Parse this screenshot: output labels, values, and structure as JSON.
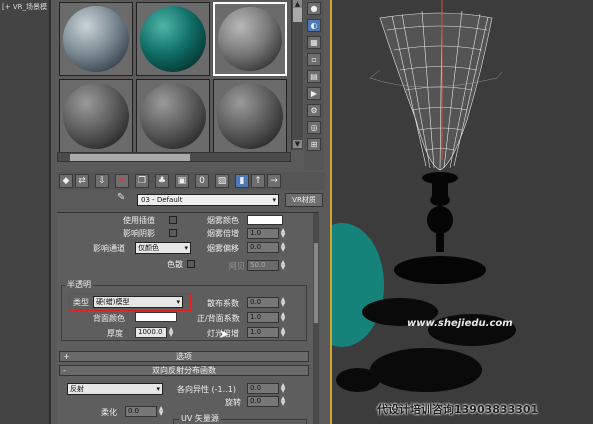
{
  "left_viewport": {
    "label": "[+ VR_场景模"
  },
  "material": {
    "name": "03 - Default",
    "type_button": "VR材质"
  },
  "sample_slots": [
    {
      "index": 1,
      "style": "textured-blue-gray"
    },
    {
      "index": 2,
      "style": "teal-glossy"
    },
    {
      "index": 3,
      "style": "gray-glossy",
      "selected": true
    },
    {
      "index": 4,
      "style": "default-gray"
    },
    {
      "index": 5,
      "style": "default-gray"
    },
    {
      "index": 6,
      "style": "default-gray"
    }
  ],
  "fog": {
    "use_interpolation": "使用插值",
    "affect_shadows": "影响阴影",
    "affect_channels": "影响通道",
    "affect_channels_value": "仅颜色",
    "dispersion": "色散",
    "fog_color": "烟雾颜色",
    "fog_multiplier": "烟雾倍增",
    "fog_multiplier_value": "1.0",
    "fog_bias": "烟雾偏移",
    "fog_bias_value": "0.0",
    "abbe": "阿贝",
    "abbe_value": "50.0"
  },
  "translucency": {
    "group_title": "半透明",
    "type_label": "类型",
    "type_value": "硬(蜡)模型",
    "scatter_coef": "散布系数",
    "scatter_coef_value": "0.0",
    "back_color": "背面颜色",
    "fwd_bck_coef": "正/背面系数",
    "fwd_bck_coef_value": "1.0",
    "thickness": "厚度",
    "thickness_value": "1000.0",
    "light_multiplier": "灯光倍增",
    "light_multiplier_value": "1.0"
  },
  "rollouts": {
    "options": "选项",
    "brdf": "双向反射分布函数"
  },
  "brdf": {
    "type_value": "反射",
    "anisotropy": "各向异性 (-1..1)",
    "anisotropy_value": "0.0",
    "rotation": "旋转",
    "rotation_value": "0.0",
    "soften": "柔化",
    "soften_value": "0.0",
    "uv_vectors": "UV 矢量源"
  },
  "watermark": "www.shejiedu.com",
  "footer_text": "代设计培训咨询13903833301",
  "colors": {
    "viewport_border": "#d2a62a",
    "selection_red": "#e02020",
    "teal": "#0f8f86"
  }
}
